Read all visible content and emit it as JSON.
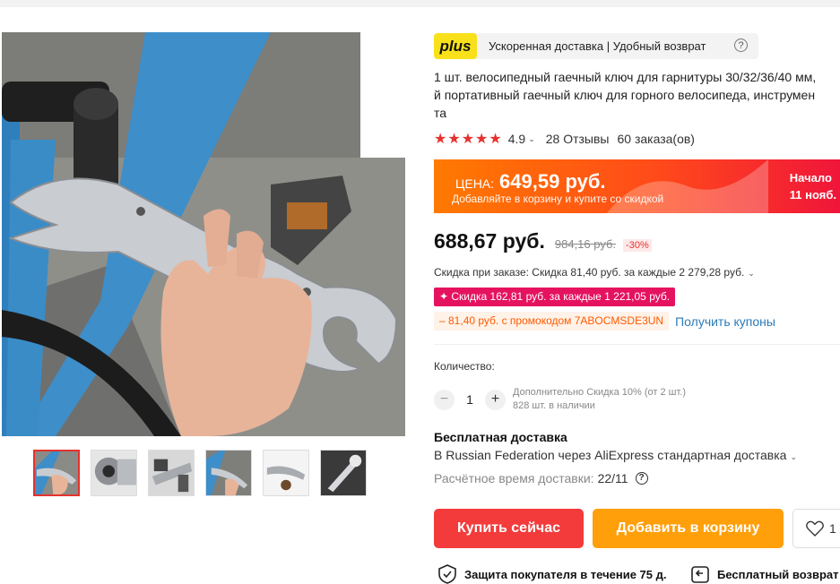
{
  "plus_bar": {
    "badge": "plus",
    "text": "Ускоренная доставка | Удобный возврат",
    "help": "?"
  },
  "product": {
    "title": "1 шт. велосипедный гаечный ключ для гарнитуры 30/32/36/40 мм,\nй портативный гаечный ключ для горного велосипеда, инструмен\nта"
  },
  "rating": {
    "stars": "★★★★★",
    "value": "4.9",
    "reviews": "28 Отзывы",
    "orders": "60 заказа(ов)"
  },
  "promo_banner": {
    "label": "ЦЕНА:",
    "price": "649,59 руб.",
    "subtitle": "Добавляйте в корзину и купите со скидкой",
    "start_line1": "Начало",
    "start_line2": "11 нояб."
  },
  "price": {
    "current": "688,67 руб.",
    "old": "984,16 руб.",
    "discount": "-30%"
  },
  "discounts": {
    "order_discount": "Скидка при заказе: Скидка 81,40 руб. за каждые 2 279,28 руб.",
    "coupon": "✦ Скидка 162,81 руб. за каждые 1 221,05 руб.",
    "promo_code": "– 81,40 руб. с промокодом 7ABOCMSDE3UN",
    "get_coupons": "Получить купоны"
  },
  "quantity": {
    "label": "Количество:",
    "minus": "−",
    "value": "1",
    "plus": "+",
    "extra_discount": "Дополнительно Скидка 10% (от 2 шт.)",
    "stock": "828 шт. в наличии"
  },
  "shipping": {
    "title": "Бесплатная доставка",
    "line": "В Russian Federation через AliExpress стандартная доставка",
    "eta_label": "Расчётное время доставки:",
    "eta_value": "22/11",
    "eta_help": "?"
  },
  "actions": {
    "buy_now": "Купить сейчас",
    "add_to_cart": "Добавить в корзину",
    "wishlist_count": "1"
  },
  "guarantees": {
    "buyer_protection": "Защита покупателя в течение 75 д.",
    "free_return": "Бесплатный возврат"
  },
  "icons": {
    "caret": "chevron-down-icon",
    "heart": "heart-icon",
    "shield": "shield-icon",
    "return": "return-icon"
  },
  "colors": {
    "accent_red": "#f33b3b",
    "accent_orange": "#ff9f0a",
    "star_red": "#e5322d",
    "plus_yellow": "#f8e11a",
    "coupon_pink": "#e5135f",
    "link_blue": "#2b7bb9"
  }
}
